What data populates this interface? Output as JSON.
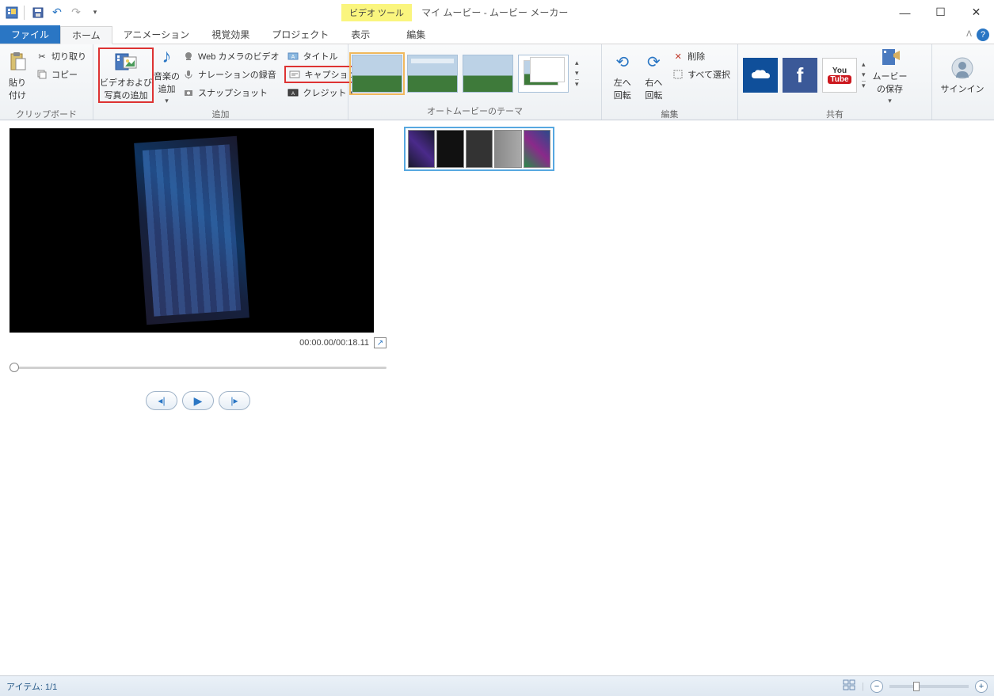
{
  "titlebar": {
    "context_tab": "ビデオ ツール",
    "title": "マイ ムービー - ムービー メーカー"
  },
  "tabs": {
    "file": "ファイル",
    "home": "ホーム",
    "animation": "アニメーション",
    "visual": "視覚効果",
    "project": "プロジェクト",
    "view": "表示",
    "edit": "編集"
  },
  "ribbon": {
    "clipboard": {
      "label": "クリップボード",
      "paste": "貼り\n付け",
      "cut": "切り取り",
      "copy": "コピー"
    },
    "add": {
      "label": "追加",
      "add_video_photo": "ビデオおよび\n写真の追加",
      "add_music": "音楽の\n追加",
      "webcam": "Web カメラのビデオ",
      "narration": "ナレーションの録音",
      "snapshot": "スナップショット",
      "title": "タイトル",
      "caption": "キャプション",
      "credits": "クレジット"
    },
    "themes": {
      "label": "オートムービーのテーマ"
    },
    "edit": {
      "label": "編集",
      "rotate_left": "左へ\n回転",
      "rotate_right": "右へ\n回転",
      "delete": "削除",
      "select_all": "すべて選択"
    },
    "share": {
      "label": "共有",
      "save_movie": "ムービー\nの保存"
    },
    "signin": {
      "label": "サインイン"
    }
  },
  "preview": {
    "time": "00:00.00/00:18.11"
  },
  "statusbar": {
    "items": "アイテム: 1/1"
  }
}
